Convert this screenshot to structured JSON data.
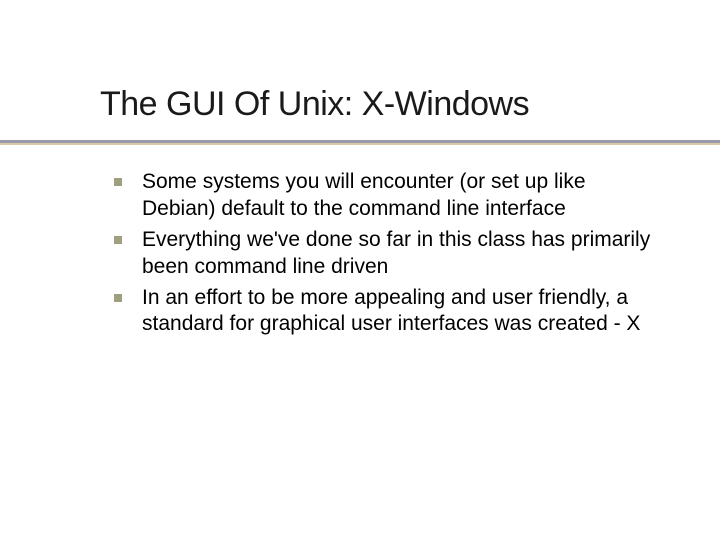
{
  "slide": {
    "title": "The GUI Of Unix: X-Windows",
    "bullets": [
      "Some systems you will encounter (or set up like Debian) default to the command line interface",
      "Everything we've done so far in this class has primarily been command line driven",
      "In an effort to be more appealing and user friendly, a standard for graphical user interfaces was created - X"
    ]
  }
}
